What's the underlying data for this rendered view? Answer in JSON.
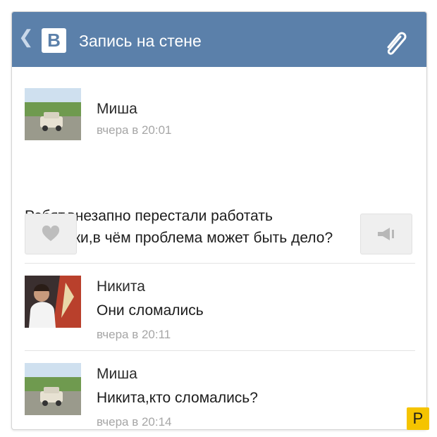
{
  "header": {
    "back_icon": "chevron-left-icon",
    "logo_letter": "В",
    "title": "Запись на стене",
    "attach_icon": "paperclip-icon"
  },
  "post": {
    "author": "Миша",
    "time": "вчера в 20:01",
    "text_line1": "Ребят,внезапно перестали работать",
    "text_line2": "дворники,в чём проблема может быть дело?",
    "like_icon": "heart-icon",
    "share_icon": "megaphone-icon"
  },
  "comments": [
    {
      "author": "Никита",
      "text": "Они сломались",
      "time": "вчера в 20:11"
    },
    {
      "author": "Миша",
      "text": "Никита,кто сломались?",
      "time": "вчера в 20:14"
    }
  ],
  "watermark": "P",
  "colors": {
    "header_bg": "#5b80aa",
    "meta_text": "#a6a6a6",
    "badge": "#f5c400"
  }
}
